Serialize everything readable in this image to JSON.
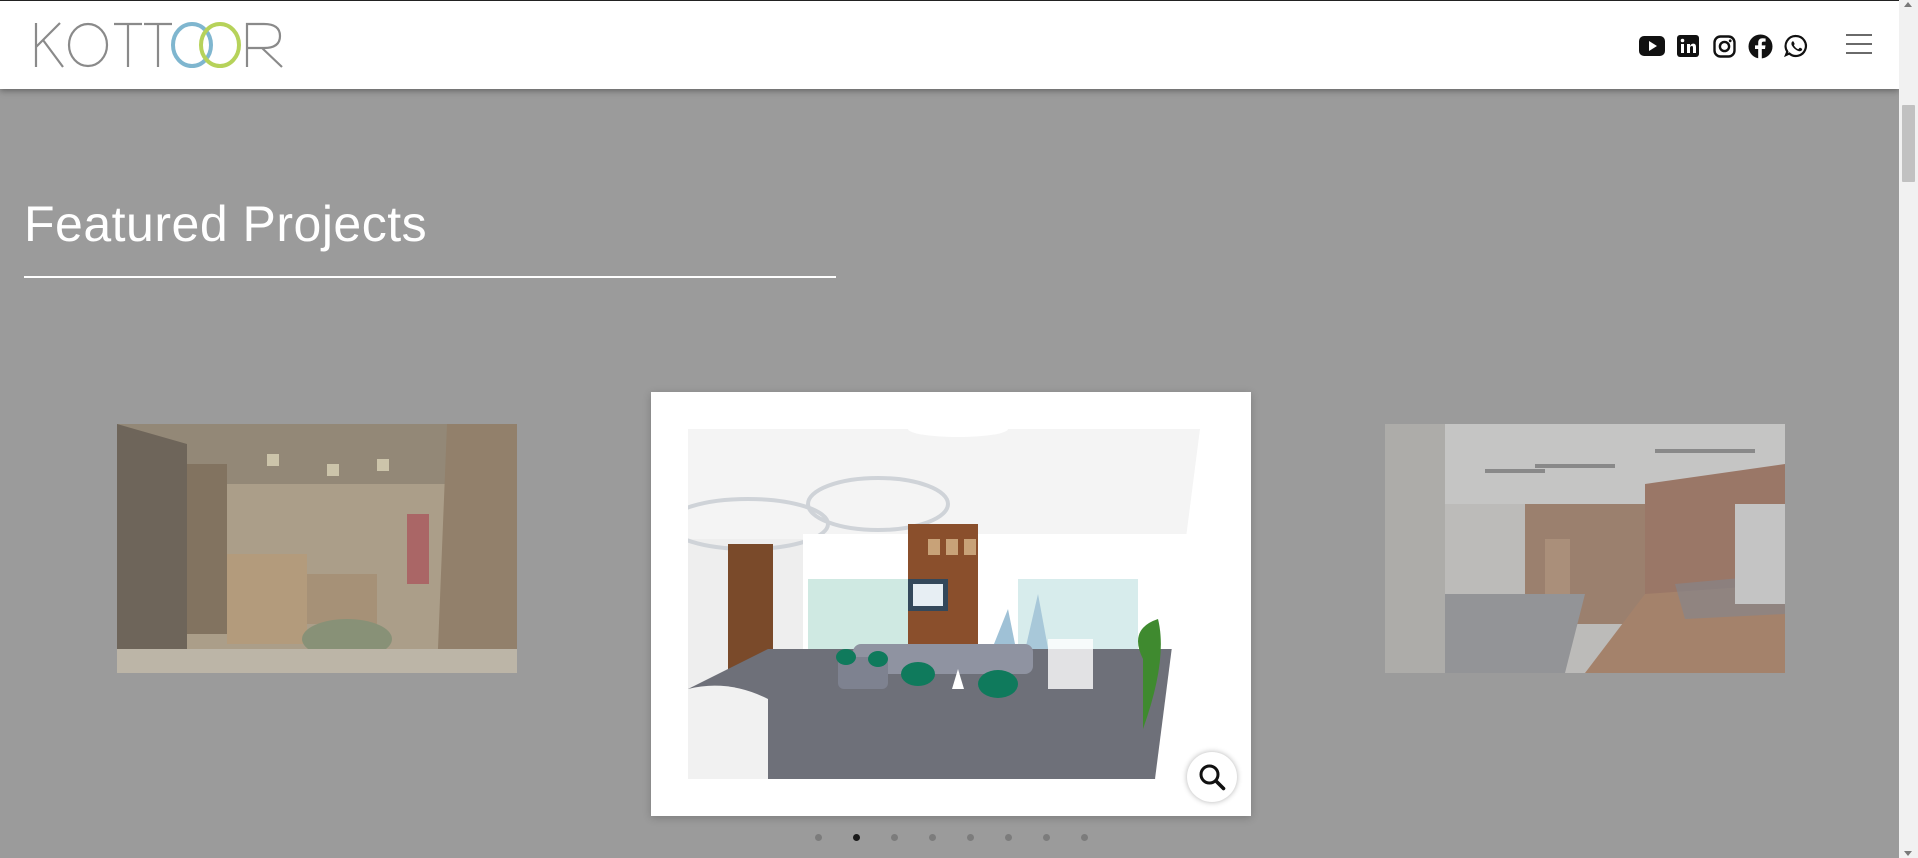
{
  "header": {
    "logo_text": "KOTTOOR",
    "social": [
      {
        "name": "youtube-icon"
      },
      {
        "name": "linkedin-icon"
      },
      {
        "name": "instagram-icon"
      },
      {
        "name": "facebook-icon"
      },
      {
        "name": "whatsapp-icon"
      }
    ]
  },
  "section": {
    "title": "Featured Projects"
  },
  "carousel": {
    "active_index": 1,
    "dot_count": 8,
    "slides": [
      {
        "name": "retail-store-project"
      },
      {
        "name": "office-lounge-project"
      },
      {
        "name": "office-meeting-room-project"
      }
    ]
  },
  "colors": {
    "background_overlay": "#9b9b9b",
    "logo_gray": "#8a8a8a",
    "ring_blue": "#7fb6cf",
    "ring_green": "#b6d25a"
  }
}
